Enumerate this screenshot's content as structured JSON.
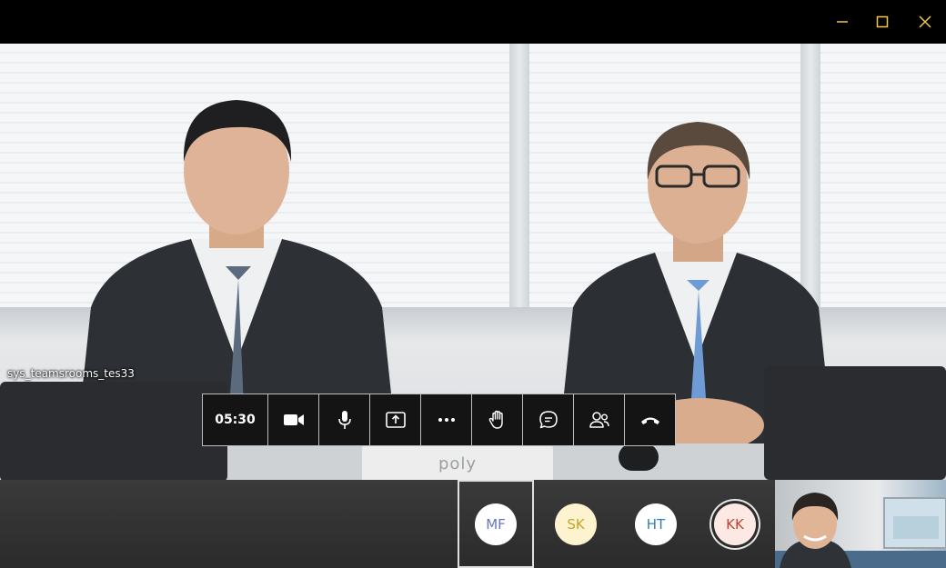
{
  "window": {
    "controls": [
      {
        "name": "minimize",
        "icon": "minimize-icon"
      },
      {
        "name": "maximize",
        "icon": "maximize-icon"
      },
      {
        "name": "close",
        "icon": "close-icon"
      }
    ],
    "control_color": "#f2c94c"
  },
  "video": {
    "participant_name": "sys_teamsrooms_tes33",
    "device_brand": "poly"
  },
  "toolbar": {
    "timer": "05:30",
    "buttons": [
      {
        "name": "camera",
        "icon": "video-camera-icon"
      },
      {
        "name": "microphone",
        "icon": "microphone-icon"
      },
      {
        "name": "share",
        "icon": "share-screen-icon"
      },
      {
        "name": "more",
        "icon": "more-options-icon"
      },
      {
        "name": "raise-hand",
        "icon": "raise-hand-icon"
      },
      {
        "name": "chat",
        "icon": "chat-icon"
      },
      {
        "name": "participants",
        "icon": "participants-icon"
      },
      {
        "name": "hang-up",
        "icon": "hang-up-icon"
      }
    ]
  },
  "participants": [
    {
      "initials": "MF",
      "bg": "#ffffff",
      "fg": "#6a73c7",
      "selected": true
    },
    {
      "initials": "SK",
      "bg": "#fdf3cf",
      "fg": "#c9a227",
      "selected": false
    },
    {
      "initials": "HT",
      "bg": "#ffffff",
      "fg": "#2f7fc0",
      "selected": false
    },
    {
      "initials": "KK",
      "bg": "#fde9e3",
      "fg": "#c2452d",
      "selected": false,
      "speaking": true
    }
  ]
}
